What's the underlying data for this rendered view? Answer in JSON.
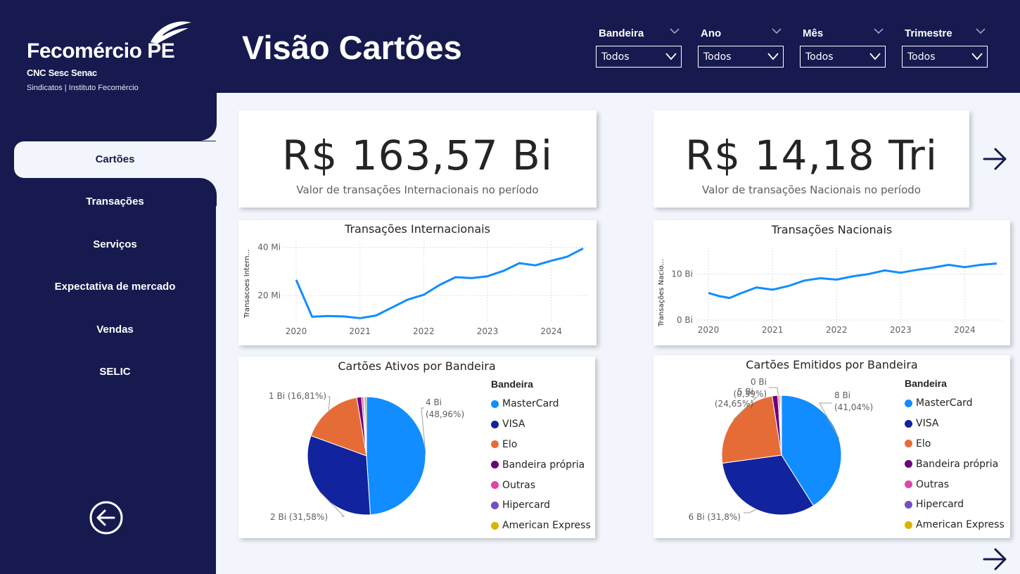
{
  "brand": {
    "name": "Fecomércio PE",
    "sub1": "CNC Sesc Senac",
    "sub2": "Sindicatos | Instituto Fecomércio"
  },
  "page_title": "Visão Cartões",
  "slicers": [
    {
      "title": "Bandeira",
      "value": "Todos"
    },
    {
      "title": "Ano",
      "value": "Todos"
    },
    {
      "title": "Mês",
      "value": "Todos"
    },
    {
      "title": "Trimestre",
      "value": "Todos"
    }
  ],
  "nav": {
    "items": [
      {
        "label": "Cartões",
        "active": true
      },
      {
        "label": "Transações"
      },
      {
        "label": "Serviços"
      },
      {
        "label": "Expectativa de mercado"
      },
      {
        "label": "Vendas"
      },
      {
        "label": "SELIC"
      }
    ]
  },
  "kpis": {
    "intl": {
      "value": "R$ 163,57 Bi",
      "label": "Valor de transações Internacionais no período"
    },
    "nac": {
      "value": "R$ 14,18 Tri",
      "label": "Valor de transações Nacionais no período"
    }
  },
  "colors": {
    "navy": "#161a4f",
    "line": "#118dff",
    "MasterCard": "#118dff",
    "VISA": "#12239e",
    "Elo": "#e66c37",
    "Bandeira própria": "#6b007b",
    "Outras": "#e044a7",
    "Hipercard": "#744ec2",
    "American Express": "#d9b300"
  },
  "chart_data": [
    {
      "type": "line",
      "title": "Transações Internacionais",
      "ylabel": "Transacoes Intern...",
      "xlabel": "",
      "x": [
        2020.0,
        2020.25,
        2020.5,
        2020.75,
        2021.0,
        2021.25,
        2021.5,
        2021.75,
        2022.0,
        2022.25,
        2022.5,
        2022.75,
        2023.0,
        2023.25,
        2023.5,
        2023.75,
        2024.0,
        2024.25,
        2024.5
      ],
      "series": [
        {
          "values": [
            26.5,
            11.2,
            11.5,
            11.3,
            10.6,
            11.7,
            15.0,
            18.3,
            20.3,
            24.4,
            27.6,
            27.2,
            28.0,
            30.2,
            33.4,
            32.5,
            34.4,
            36.1,
            39.5
          ]
        }
      ],
      "x_ticks": [
        "2020",
        "2021",
        "2022",
        "2023",
        "2024"
      ],
      "y_ticks": [
        "20 Mi",
        "40 Mi"
      ],
      "ylim": [
        10,
        40
      ],
      "grid": true
    },
    {
      "type": "line",
      "title": "Transações Nacionais",
      "ylabel": "Transações Nacio...",
      "xlabel": "",
      "x": [
        2020.0,
        2020.17,
        2020.33,
        2020.5,
        2020.75,
        2021.0,
        2021.25,
        2021.5,
        2021.75,
        2022.0,
        2022.25,
        2022.5,
        2022.75,
        2023.0,
        2023.25,
        2023.5,
        2023.75,
        2024.0,
        2024.25,
        2024.5
      ],
      "series": [
        {
          "values": [
            5.9,
            5.2,
            4.8,
            5.8,
            7.1,
            6.6,
            7.4,
            8.6,
            9.1,
            8.8,
            9.5,
            10.0,
            10.8,
            10.3,
            10.9,
            11.4,
            12.0,
            11.5,
            12.0,
            12.3
          ]
        }
      ],
      "x_ticks": [
        "2020",
        "2021",
        "2022",
        "2023",
        "2024"
      ],
      "y_ticks": [
        "0 Bi",
        "10 Bi"
      ],
      "ylim": [
        0,
        13
      ],
      "grid": true
    },
    {
      "type": "pie",
      "title": "Cartões Ativos por Bandeira",
      "legend_title": "Bandeira",
      "categories": [
        "MasterCard",
        "VISA",
        "Elo",
        "Bandeira própria",
        "Outras",
        "Hipercard",
        "American Express"
      ],
      "values": [
        48.96,
        31.58,
        16.81,
        1.3,
        0.5,
        0.3,
        0.55
      ],
      "data_labels": [
        {
          "category": "MasterCard",
          "lines": [
            "4 Bi",
            "(48,96%)"
          ]
        },
        {
          "category": "VISA",
          "lines": [
            "2 Bi (31,58%)"
          ]
        },
        {
          "category": "Elo",
          "lines": [
            "1 Bi (16,81%)"
          ]
        }
      ],
      "legend": "right"
    },
    {
      "type": "pie",
      "title": "Cartões Emitidos por Bandeira",
      "legend_title": "Bandeira",
      "categories": [
        "MasterCard",
        "VISA",
        "Elo",
        "Bandeira própria",
        "Outras",
        "Hipercard",
        "American Express"
      ],
      "values": [
        41.04,
        31.8,
        24.65,
        1.5,
        0.39,
        0.3,
        0.32
      ],
      "data_labels": [
        {
          "category": "MasterCard",
          "lines": [
            "8 Bi",
            "(41,04%)"
          ]
        },
        {
          "category": "VISA",
          "lines": [
            "6 Bi (31,8%)"
          ]
        },
        {
          "category": "Elo",
          "lines": [
            "5 Bi",
            "(24,65%)"
          ]
        },
        {
          "category": "Outras",
          "lines": [
            "0 Bi",
            "(0,39%)"
          ]
        }
      ],
      "legend": "right"
    }
  ]
}
